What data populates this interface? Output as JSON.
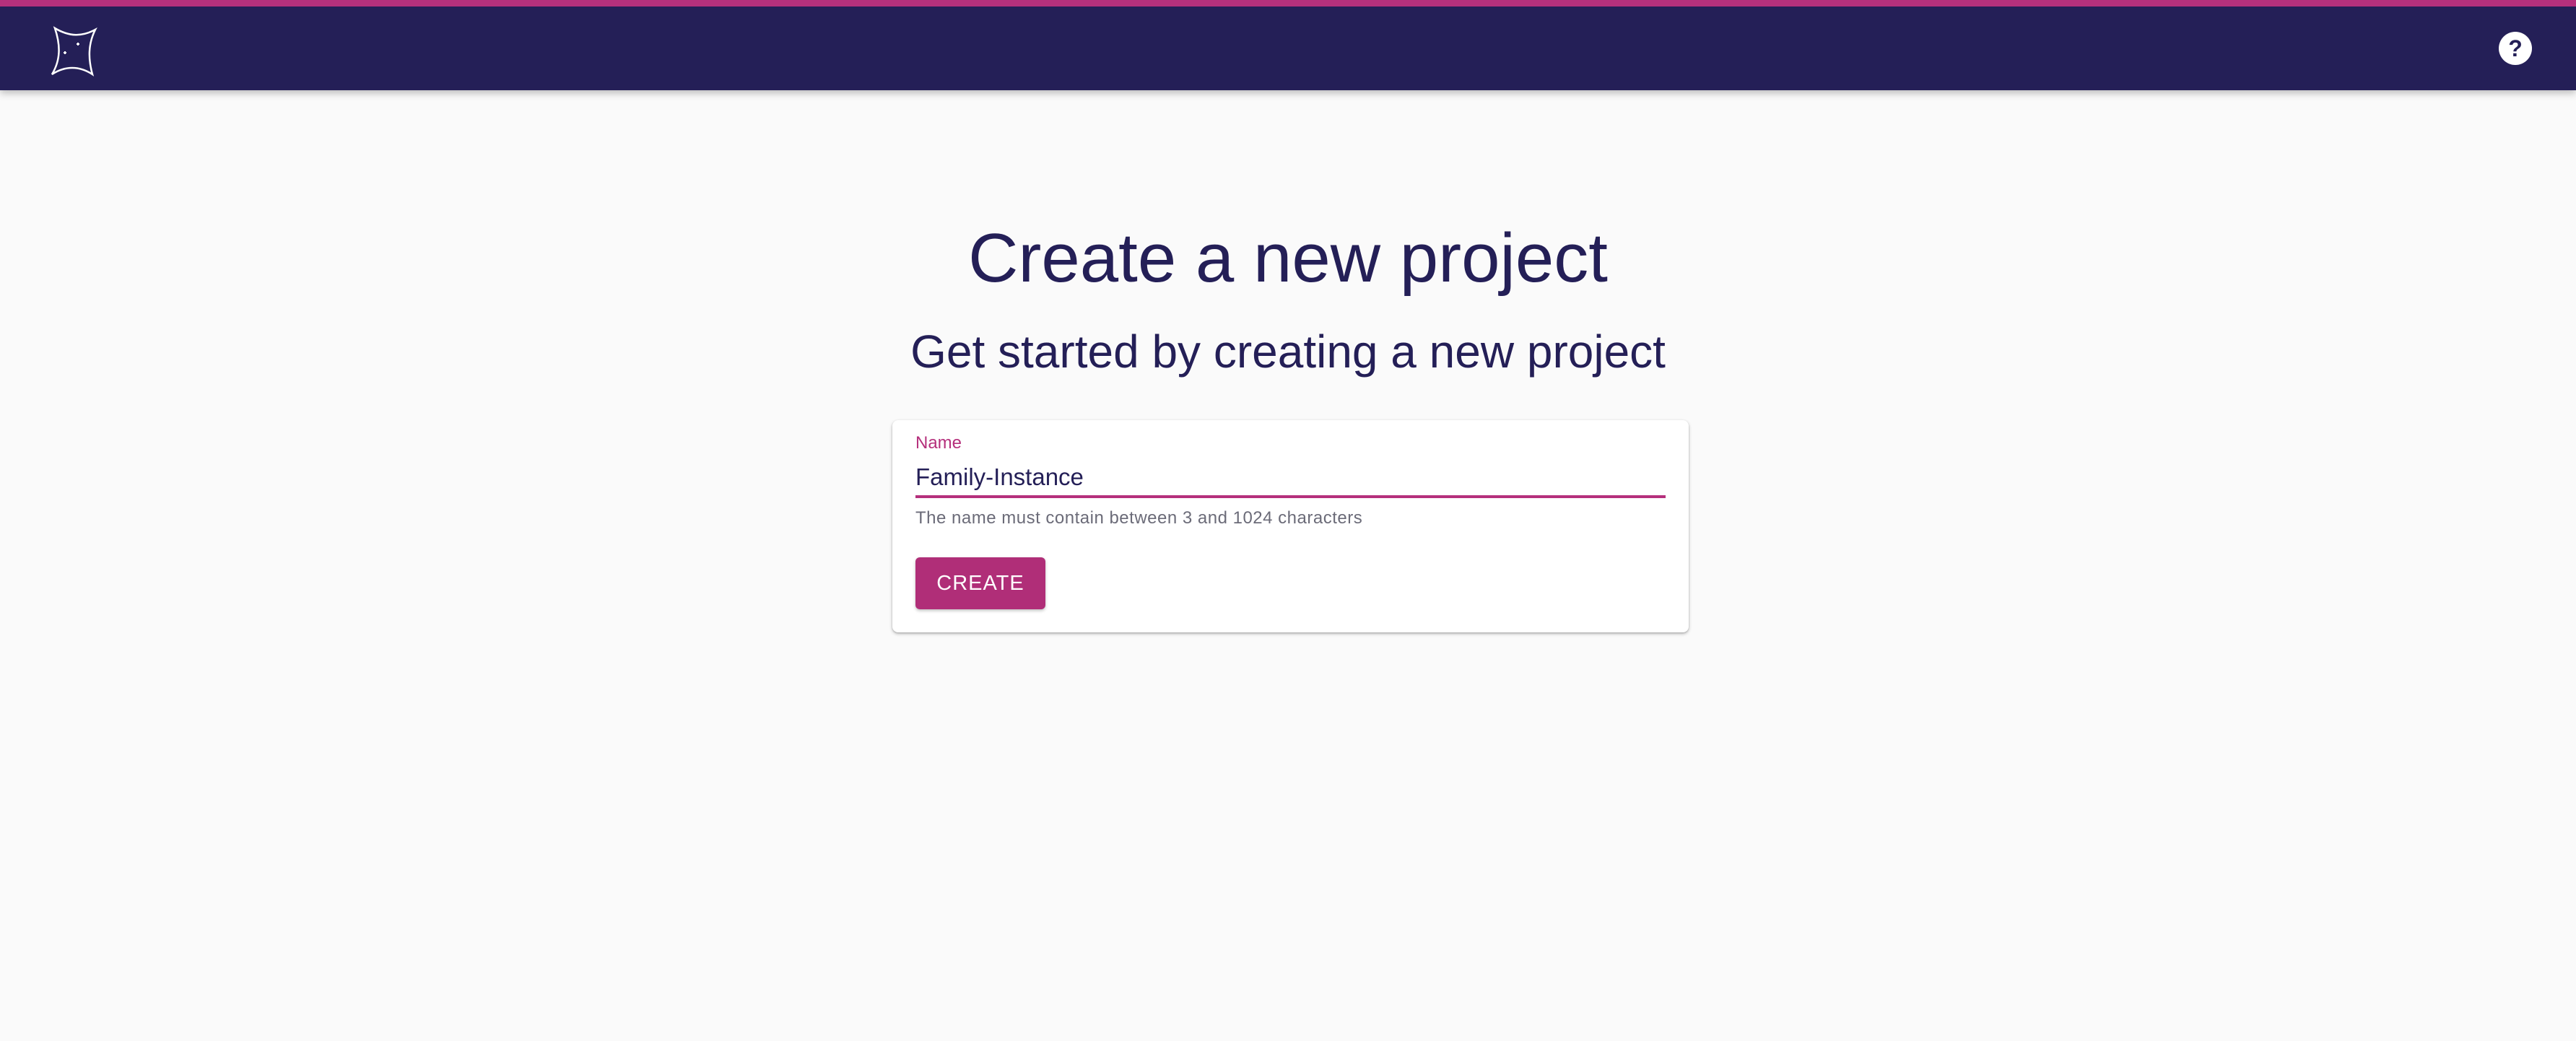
{
  "header": {
    "logo_icon": "sparkle-star-logo",
    "help_icon": "help-circle-icon",
    "help_glyph": "?",
    "colors": {
      "bar": "#241f57",
      "accent": "#b5307c"
    }
  },
  "main": {
    "title": "Create a new project",
    "subtitle": "Get started by creating a new project"
  },
  "form": {
    "name_label": "Name",
    "name_value": "Family-Instance",
    "name_hint": "The name must contain between 3 and 1024 characters",
    "create_label": "CREATE"
  }
}
